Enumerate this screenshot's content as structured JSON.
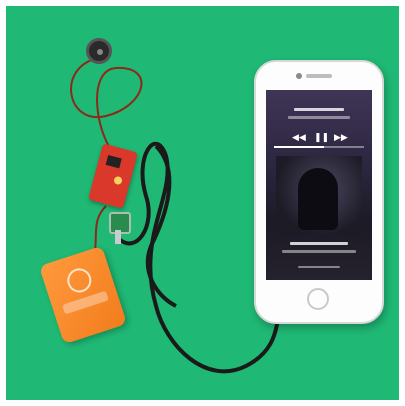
{
  "scene": {
    "background_color": "#1fb874",
    "objects": [
      "piezo-contact-microphone",
      "amplifier-circuit-board",
      "volume-potentiometer",
      "battery-pack",
      "audio-cable",
      "smartphone"
    ]
  },
  "phone": {
    "screen": {
      "controls": {
        "prev_icon": "previous-track-icon",
        "pause_icon": "pause-icon",
        "next_icon": "next-track-icon"
      },
      "playback_progress": 0.55
    }
  },
  "battery": {
    "color": "#f27c1c",
    "logo_icon": "brand-logo"
  }
}
